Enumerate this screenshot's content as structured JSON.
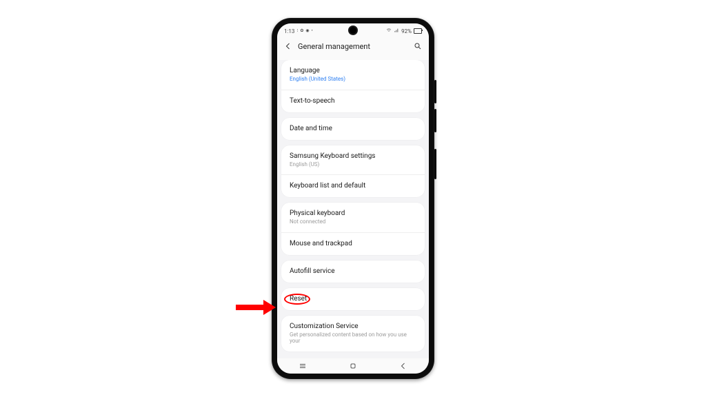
{
  "status": {
    "time": "1:13",
    "battery_pct": "92%"
  },
  "header": {
    "title": "General management"
  },
  "groups": [
    {
      "items": [
        {
          "label": "Language",
          "sub": "English (United States)",
          "sub_link": true
        },
        {
          "label": "Text-to-speech"
        }
      ]
    },
    {
      "items": [
        {
          "label": "Date and time"
        }
      ]
    },
    {
      "items": [
        {
          "label": "Samsung Keyboard settings",
          "sub": "English (US)"
        },
        {
          "label": "Keyboard list and default"
        }
      ]
    },
    {
      "items": [
        {
          "label": "Physical keyboard",
          "sub": "Not connected"
        },
        {
          "label": "Mouse and trackpad"
        }
      ]
    },
    {
      "items": [
        {
          "label": "Autofill service"
        }
      ]
    },
    {
      "items": [
        {
          "label": "Reset",
          "highlight": true
        }
      ]
    },
    {
      "items": [
        {
          "label": "Customization Service",
          "sub": "Get personalized content based on how you use your"
        }
      ]
    }
  ]
}
